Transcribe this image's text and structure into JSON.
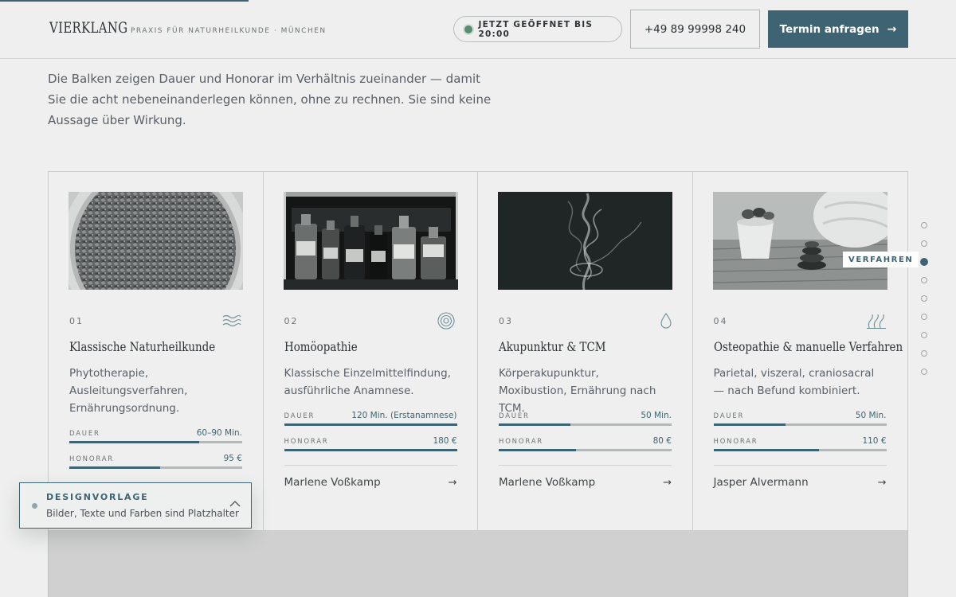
{
  "header": {
    "brand": "VIERKLANG",
    "tagline": "PRAXIS FÜR NATURHEILKUNDE · MÜNCHEN",
    "open_status": "JETZT GEÖFFNET BIS 20:00",
    "phone": "+49 89 99998 240",
    "cta_label": "Termin anfragen",
    "cta_arrow": "→"
  },
  "intro": "Die Balken zeigen Dauer und Honorar im Verhältnis zueinander — damit Sie die acht nebeneinanderlegen können, ohne zu rechnen. Sie sind keine Aussage über Wirkung.",
  "cards": [
    {
      "num": "01",
      "icon": "waves-icon",
      "title": "Klassische Naturheilkunde",
      "desc": "Phytotherapie, Ausleitungsverfahren, Ernährungsordnung.",
      "duration_label": "DAUER",
      "duration_value": "60–90 Min.",
      "duration_fill": 0.75,
      "fee_label": "HONORAR",
      "fee_value": "95 €",
      "fee_fill": 0.525,
      "practitioner": "",
      "arrow": ""
    },
    {
      "num": "02",
      "icon": "target-icon",
      "title": "Homöopathie",
      "desc": "Klassische Einzelmittelfindung, ausführliche Anamnese.",
      "duration_label": "DAUER",
      "duration_value": "120 Min. (Erstanamnese)",
      "duration_fill": 1.0,
      "fee_label": "HONORAR",
      "fee_value": "180 €",
      "fee_fill": 1.0,
      "practitioner": "Marlene Voßkamp",
      "arrow": "→"
    },
    {
      "num": "03",
      "icon": "drop-icon",
      "title": "Akupunktur & TCM",
      "desc": "Körperakupunktur, Moxibustion, Ernährung nach TCM.",
      "duration_label": "DAUER",
      "duration_value": "50 Min.",
      "duration_fill": 0.415,
      "fee_label": "HONORAR",
      "fee_value": "80 €",
      "fee_fill": 0.445,
      "practitioner": "Marlene Voßkamp",
      "arrow": "→"
    },
    {
      "num": "04",
      "icon": "heat-waves-icon",
      "title": "Osteopathie & manuelle Verfahren",
      "desc": "Parietal, viszeral, craniosacral — nach Befund kombiniert.",
      "duration_label": "DAUER",
      "duration_value": "50 Min.",
      "duration_fill": 0.415,
      "fee_label": "HONORAR",
      "fee_value": "110 €",
      "fee_fill": 0.61,
      "practitioner": "Jasper Alvermann",
      "arrow": "→"
    }
  ],
  "sidenav": {
    "dots": 9,
    "active_index": 2,
    "active_label": "VERFAHREN"
  },
  "badge": {
    "title": "DESIGNVORLAGE",
    "subtitle": "Bilder, Texte und Farben sind Platzhalter"
  },
  "colors": {
    "accent": "#3e6473",
    "background": "#eeefee",
    "open_dot": "#5b8a72"
  }
}
